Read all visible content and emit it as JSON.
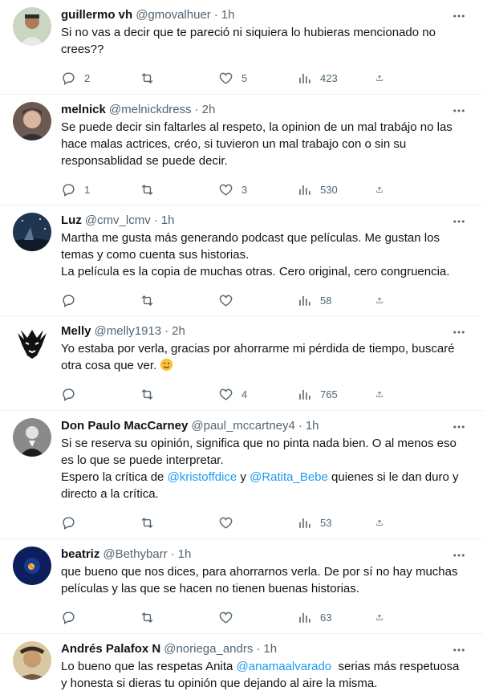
{
  "tweets": [
    {
      "name": "guillermo vh",
      "handle": "@gmovalhuer",
      "time": "1h",
      "lines": [
        "Si no vas a decir que te pareció ni siquiera lo hubieras mencionado no",
        "crees??"
      ],
      "replies": "2",
      "retweets": "",
      "likes": "5",
      "views": "423"
    },
    {
      "name": "melnick",
      "handle": "@melnickdress",
      "time": "2h",
      "lines": [
        "Se puede decir sin faltarles al respeto, la opinion de un mal trabájo no las",
        "hace malas actrices, créo, si tuvieron un mal trabajo con o sin su",
        "responsablidad se puede decir."
      ],
      "replies": "1",
      "retweets": "",
      "likes": "3",
      "views": "530"
    },
    {
      "name": "Luz",
      "handle": "@cmv_lcmv",
      "time": "1h",
      "lines": [
        "Martha me gusta más generando podcast que películas. Me gustan los",
        "temas y como cuenta sus historias.",
        "La película es la copia de muchas otras. Cero original, cero congruencia."
      ],
      "replies": "",
      "retweets": "",
      "likes": "",
      "views": "58"
    },
    {
      "name": "Melly",
      "handle": "@melly1913",
      "time": "2h",
      "lines": [
        "Yo estaba por verla, gracias por ahorrarme mi pérdida de tiempo, buscaré",
        "otra cosa que ver."
      ],
      "emoji": "winking-face",
      "replies": "",
      "retweets": "",
      "likes": "4",
      "views": "765"
    },
    {
      "name": "Don Paulo MacCarney",
      "handle": "@paul_mccartney4",
      "time": "1h",
      "line1": "Si se reserva su opinión, significa que no pinta nada bien. O al menos eso",
      "line2": "es lo que se puede interpretar.",
      "line3_pre": "Espero la crítica de ",
      "mention1": "@kristoffdice",
      "line3_mid": " y ",
      "mention2": "@Ratita_Bebe",
      "line3_post": " quienes si le dan duro y",
      "line4": "directo a la crítica.",
      "replies": "",
      "retweets": "",
      "likes": "",
      "views": "53"
    },
    {
      "name": "beatriz",
      "handle": "@Bethybarr",
      "time": "1h",
      "lines": [
        "que bueno que nos dices, para ahorrarnos verla. De por sí no hay muchas",
        "películas y las que se hacen no tienen buenas historias."
      ],
      "replies": "",
      "retweets": "",
      "likes": "",
      "views": "63"
    },
    {
      "name": "Andrés Palafox N",
      "handle": "@noriega_andrs",
      "time": "1h",
      "line1_pre": "Lo bueno que las respetas Anita ",
      "mention1": "@anamaalvarado",
      "line1_post": "  serias más respetuosa",
      "line2": "y honesta si dieras tu opinión que dejando al aire la misma."
    }
  ],
  "separator": "·",
  "icons": {
    "reply": "reply-icon",
    "retweet": "retweet-icon",
    "like": "like-icon",
    "views": "views-icon",
    "share": "share-icon",
    "more": "more-icon"
  },
  "colors": {
    "text": "#0f1419",
    "secondary": "#536471",
    "link": "#1d9bf0",
    "border": "#eff3f4"
  }
}
